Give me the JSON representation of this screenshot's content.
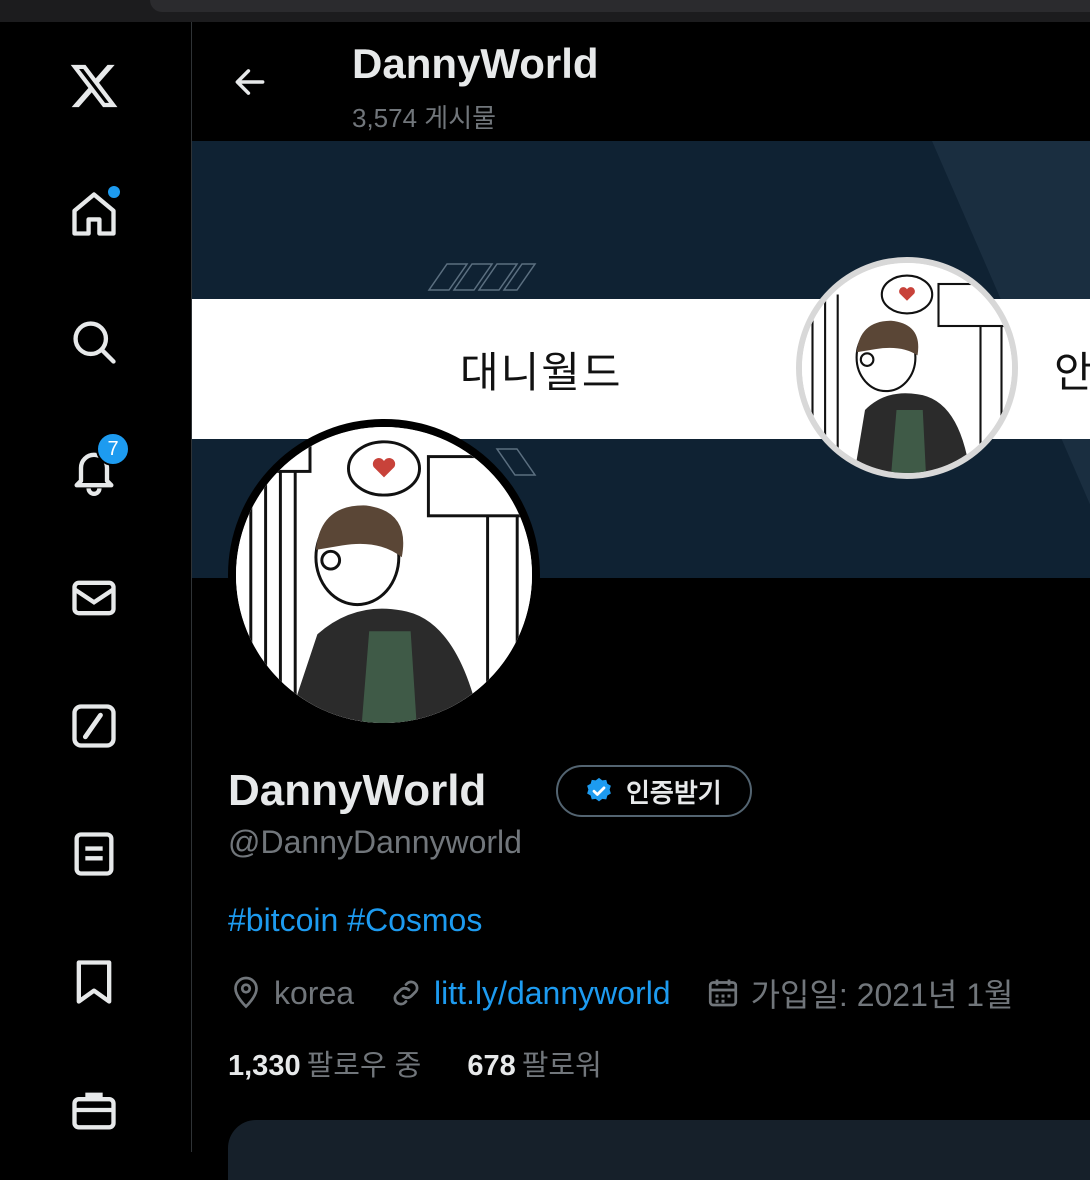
{
  "header": {
    "title": "DannyWorld",
    "post_count": "3,574 게시물"
  },
  "banner": {
    "stripe_text": "대니월드",
    "stripe_text_cut": "안"
  },
  "sidebar": {
    "notifications_badge": "7"
  },
  "profile": {
    "display_name": "DannyWorld",
    "verify_label": "인증받기",
    "handle": "@DannyDannyworld",
    "bio_tags": [
      "#bitcoin",
      "#Cosmos"
    ],
    "location": "korea",
    "link": "litt.ly/dannyworld",
    "joined": "가입일: 2021년 1월",
    "following_count": "1,330",
    "following_label": "팔로우 중",
    "followers_count": "678",
    "followers_label": "팔로워"
  },
  "colors": {
    "accent": "#1d9bf0",
    "muted": "#71767b",
    "banner_bg": "#0f2233"
  },
  "icons": [
    "x-logo-icon",
    "home-icon",
    "search-icon",
    "bell-icon",
    "mail-icon",
    "grok-icon",
    "list-icon",
    "bookmark-icon",
    "briefcase-icon",
    "back-arrow-icon",
    "verified-badge-icon",
    "location-pin-icon",
    "link-icon",
    "calendar-icon"
  ]
}
